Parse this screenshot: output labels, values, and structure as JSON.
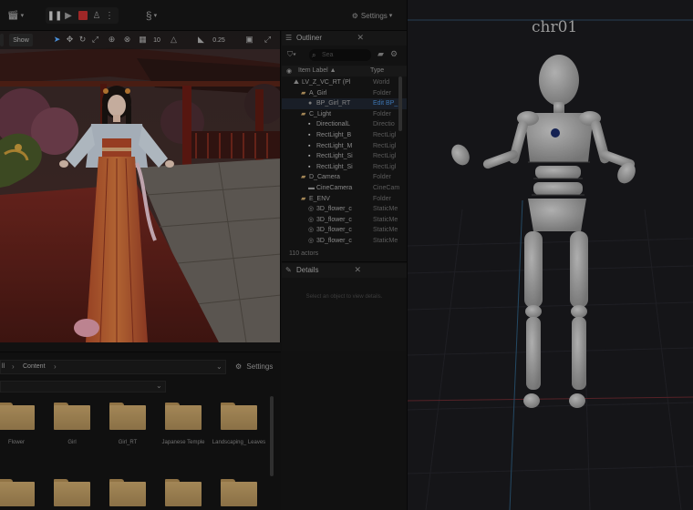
{
  "toolbar": {
    "settings_label": "Settings"
  },
  "viewport": {
    "show_label": "Show",
    "grid_value": "10",
    "scale_value": "0.25"
  },
  "outliner": {
    "tab_label": "Outliner",
    "search_placeholder": "Sea",
    "col_label": "Item Label ▲",
    "col_type": "Type",
    "rows": [
      {
        "label": "LV_Z_VC_RT (Pl",
        "type": "World",
        "indent": 0,
        "icon": "world"
      },
      {
        "label": "A_Girl",
        "type": "Folder",
        "indent": 1,
        "icon": "folder"
      },
      {
        "label": "BP_Girl_RT",
        "type": "Edit BP_",
        "indent": 2,
        "icon": "actor"
      },
      {
        "label": "C_Light",
        "type": "Folder",
        "indent": 1,
        "icon": "folder"
      },
      {
        "label": "DirectionalL",
        "type": "Directio",
        "indent": 2,
        "icon": "light"
      },
      {
        "label": "RectLight_B",
        "type": "RectLigl",
        "indent": 2,
        "icon": "light"
      },
      {
        "label": "RectLight_M",
        "type": "RectLigl",
        "indent": 2,
        "icon": "light"
      },
      {
        "label": "RectLight_Si",
        "type": "RectLigl",
        "indent": 2,
        "icon": "light"
      },
      {
        "label": "RectLight_Si",
        "type": "RectLigl",
        "indent": 2,
        "icon": "light"
      },
      {
        "label": "D_Camera",
        "type": "Folder",
        "indent": 1,
        "icon": "folder"
      },
      {
        "label": "CineCamera",
        "type": "CineCam",
        "indent": 2,
        "icon": "camera"
      },
      {
        "label": "E_ENV",
        "type": "Folder",
        "indent": 1,
        "icon": "folder"
      },
      {
        "label": "3D_flower_c",
        "type": "StaticMe",
        "indent": 2,
        "icon": "mesh"
      },
      {
        "label": "3D_flower_c",
        "type": "StaticMe",
        "indent": 2,
        "icon": "mesh"
      },
      {
        "label": "3D_flower_c",
        "type": "StaticMe",
        "indent": 2,
        "icon": "mesh"
      },
      {
        "label": "3D_flower_c",
        "type": "StaticMe",
        "indent": 2,
        "icon": "mesh"
      }
    ],
    "actor_count": "110 actors"
  },
  "details": {
    "tab_label": "Details",
    "empty_text": "Select an object to view details."
  },
  "content_browser": {
    "path_all": "ll",
    "path_content": "Content",
    "settings_label": "Settings",
    "folders": [
      "Flower",
      "Girl",
      "Girl_RT",
      "Japanese Temple",
      "Landscaping_ Leaves"
    ],
    "second_row_count": 5
  },
  "character_view": {
    "label": "chr01"
  },
  "colors": {
    "accent": "#4a8fd8",
    "folder": "#c7a46a",
    "mannequin": "#b8b8b8"
  }
}
